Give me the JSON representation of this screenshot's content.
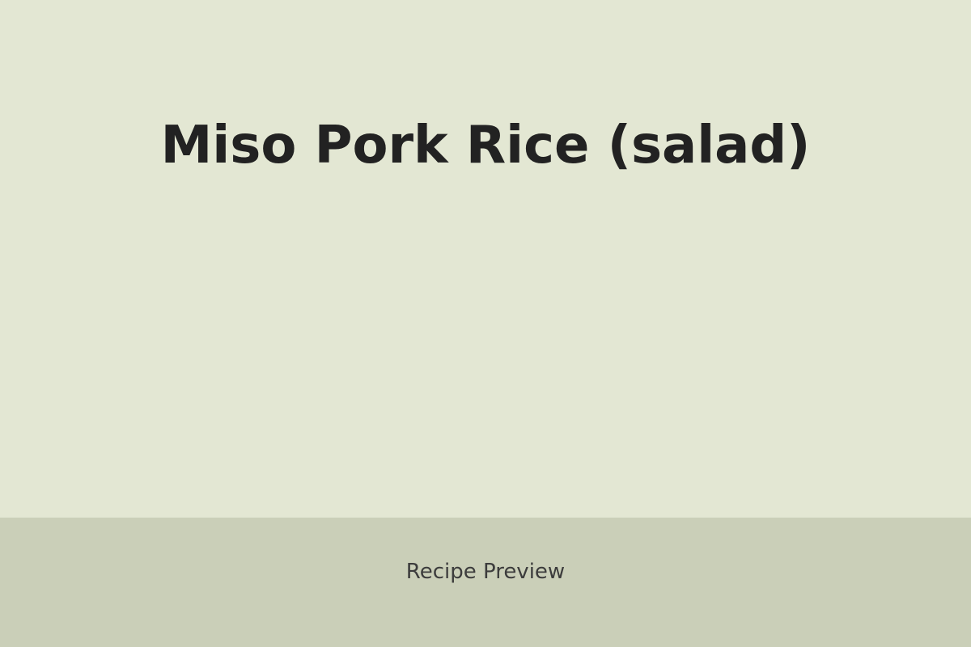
{
  "colors": {
    "background": "#e3e7d3",
    "footer_background": "#cacfb8",
    "title_text": "#222222",
    "footer_text": "#3c3c3c"
  },
  "header": {
    "title": "Miso Pork Rice (salad)"
  },
  "footer": {
    "label": "Recipe Preview"
  }
}
